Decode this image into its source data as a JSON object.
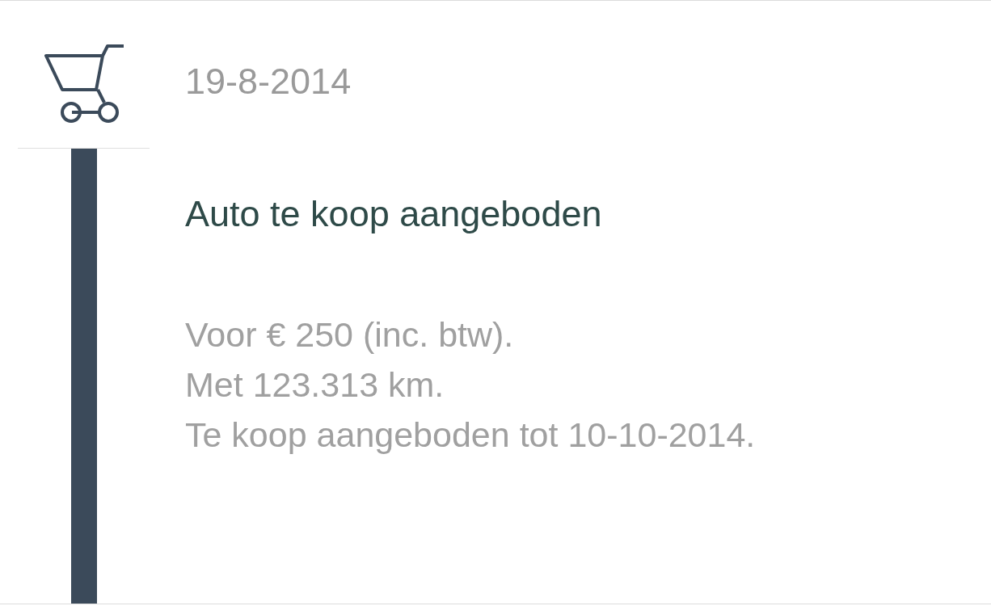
{
  "event": {
    "date": "19-8-2014",
    "title": "Auto te koop aangeboden",
    "details": [
      "Voor € 250 (inc. btw).",
      "Met 123.313 km.",
      "Te koop aangeboden tot 10-10-2014."
    ]
  }
}
